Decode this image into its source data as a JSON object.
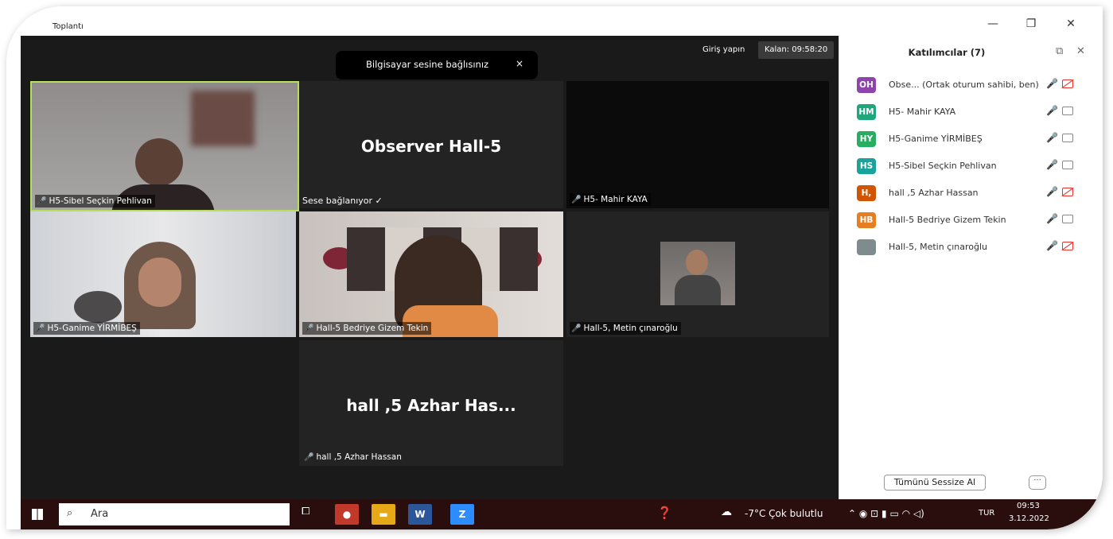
{
  "window": {
    "title": "Toplantı",
    "minimize": "—",
    "restore": "❐",
    "close": "✕"
  },
  "topbar": {
    "signin": "Giriş yapın",
    "timer": "Kalan: 09:58:20"
  },
  "toast": {
    "message": "Bilgisayar sesine bağlısınız",
    "close": "×"
  },
  "tiles": {
    "sibel": "H5-Sibel Seçkin Pehlivan",
    "observer_big": "Observer  Hall-5",
    "observer_status": "Sese bağlanıyor ✓",
    "mahir": "H5- Mahir KAYA",
    "ganime": "H5-Ganime YİRMİBEŞ",
    "bedriye": "Hall-5 Bedriye Gizem Tekin",
    "metin": "Hall-5, Metin çınaroğlu",
    "azhar_big": "hall ,5 Azhar Has...",
    "azhar": "hall ,5 Azhar Hassan"
  },
  "panel": {
    "title": "Katılımcılar (7)",
    "participants": [
      {
        "initials": "OH",
        "name": "Obse... (Ortak oturum sahibi, ben)",
        "color": "#8e44ad",
        "video": "off"
      },
      {
        "initials": "HM",
        "name": "H5- Mahir KAYA",
        "color": "#1fa67a",
        "video": "on"
      },
      {
        "initials": "HY",
        "name": "H5-Ganime YİRMİBEŞ",
        "color": "#27ae60",
        "video": "on"
      },
      {
        "initials": "HS",
        "name": "H5-Sibel Seçkin Pehlivan",
        "color": "#1aa39a",
        "video": "on"
      },
      {
        "initials": "H,",
        "name": "hall ,5 Azhar Hassan",
        "color": "#d35400",
        "video": "off"
      },
      {
        "initials": "HB",
        "name": "Hall-5 Bedriye Gizem Tekin",
        "color": "#e67e22",
        "video": "on"
      },
      {
        "initials": "",
        "name": "Hall-5, Metin çınaroğlu",
        "color": "#7f8c8d",
        "video": "off"
      }
    ],
    "mute_all": "Tümünü Sessize Al",
    "more": "···"
  },
  "taskbar": {
    "search": "Ara",
    "weather": "-7°C  Çok bulutlu",
    "lang": "TUR",
    "time": "09:53",
    "date": "3.12.2022"
  }
}
